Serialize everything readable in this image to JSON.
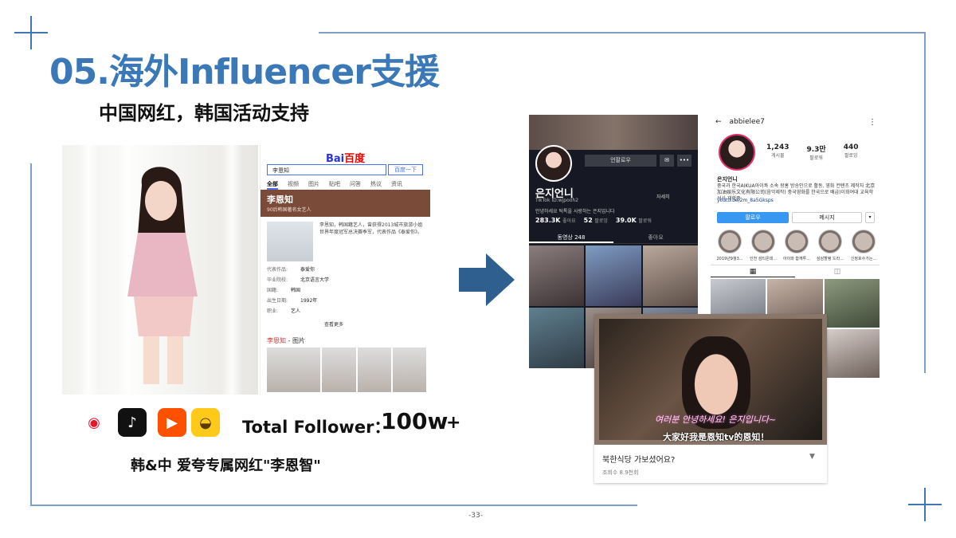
{
  "slide": {
    "title": "05.海外Influencer支援",
    "subtitle": "中国网红，韩国活动支持",
    "page_number": "-33-",
    "accent_color": "#3a78b8"
  },
  "baidu": {
    "logo_left": "Bai",
    "logo_right": "百度",
    "search_value": "李恩知",
    "search_button": "百度一下",
    "tabs": [
      "全部",
      "视频",
      "图片",
      "贴吧",
      "问答",
      "热议",
      "资讯"
    ],
    "person_name": "李恩知",
    "person_desc": "90后韩国著名女艺人",
    "intro": "李恩知，韩国籍艺人，曾获得2013城市旅游小姐世界年度冠军总决赛季军，代表作品《泰爱你》。",
    "info": [
      {
        "label": "代表作品:",
        "value": "泰爱你"
      },
      {
        "label": "毕业院校:",
        "value": "北京语言大学"
      },
      {
        "label": "国籍:",
        "value": "韩国"
      },
      {
        "label": "出生日期:",
        "value": "1992年"
      },
      {
        "label": "职业:",
        "value": "艺人"
      }
    ],
    "more": "查看更多",
    "gallery_title": "李恩知",
    "gallery_suffix": " - 图片"
  },
  "social": {
    "icons": [
      {
        "name": "weibo-icon",
        "glyph": "◉",
        "color": "#e6162d",
        "bg": "#ffffff"
      },
      {
        "name": "douyin-icon",
        "glyph": "♪",
        "color": "#ffffff",
        "bg": "#111111"
      },
      {
        "name": "kuaishou-icon",
        "glyph": "▶",
        "color": "#ffffff",
        "bg": "#ff5000"
      },
      {
        "name": "haokan-icon",
        "glyph": "◒",
        "color": "#5a3a00",
        "bg": "#ffc91a"
      }
    ],
    "follower_label": "Total Follower：",
    "follower_count": "100w",
    "plus": "+",
    "caption": "韩&中 爱夸专属网红\"李恩智\""
  },
  "tiktok": {
    "follow_button": "언팔로우",
    "name": "은지언니",
    "id": "TikTok ID:wjpooh2",
    "link": "자세히",
    "bio": "안녕하세요 틱톡을 사랑하는 은지입니다",
    "stats": [
      {
        "num": "283.3K",
        "label": "좋아요"
      },
      {
        "num": "52",
        "label": "팔로잉"
      },
      {
        "num": "39.0K",
        "label": "팔로워"
      }
    ],
    "tabs": [
      "동영상 248",
      "좋아요"
    ]
  },
  "instagram": {
    "username": "abbielee7",
    "stats": [
      {
        "num": "1,243",
        "label": "게시물"
      },
      {
        "num": "9.3만",
        "label": "팔로워"
      },
      {
        "num": "440",
        "label": "팔로잉"
      }
    ],
    "display_name": "은지언니",
    "bio": "중국과 한국AIKUA아이콰 소속 왕홍 방송인으로 활동, 영화 컨텐츠 제작자 北京加油娱乐文化有限公司(음악제작) 중국영화를 한국으로 배급)이화여대 교육학 석사 재학중",
    "link": "youtu.be/2m_8a5Gksps",
    "follow_button": "팔로우",
    "message_button": "메시지",
    "highlights": [
      "2019년9월3...",
      "인천 섬티온데...",
      "아이와 함께투...",
      "삼삼할랭 드라...",
      "신정호수가는..."
    ]
  },
  "video": {
    "subtitle_ko": "여러분 안녕하세요! 은지입니다~",
    "subtitle_cn": "大家好我是恩知tv的恩知！",
    "title": "북한식당 가보셨어요?",
    "views": "조회수 8.9천회"
  }
}
